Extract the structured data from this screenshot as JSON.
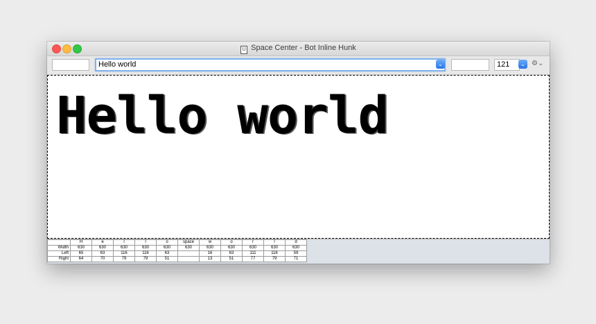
{
  "window": {
    "title": "Space Center - Bot Inline Hunk",
    "doc_icon": "U"
  },
  "toolbar": {
    "field1_value": "",
    "text_value": "Hello world",
    "field3_value": "",
    "size_value": "121"
  },
  "canvas": {
    "preview_text": "Hello world"
  },
  "metrics": {
    "row_labels": [
      "Width",
      "Left",
      "Right"
    ],
    "glyphs": [
      "H",
      "e",
      "l",
      "l",
      "o",
      "space",
      "w",
      "o",
      "r",
      "l",
      "d"
    ],
    "width": [
      "630",
      "630",
      "630",
      "630",
      "630",
      "630",
      "630",
      "630",
      "630",
      "630",
      "630"
    ],
    "left": [
      "65",
      "63",
      "116",
      "116",
      "63",
      "",
      "16",
      "63",
      "111",
      "116",
      "59"
    ],
    "right": [
      "64",
      "70",
      "79",
      "79",
      "51",
      "",
      "13",
      "51",
      "77",
      "79",
      "71"
    ]
  },
  "colors": {
    "accent": "#3b7de9",
    "close": "#fc5753",
    "minimize": "#fdbc40",
    "maximize": "#33c748"
  },
  "icons": [
    "close-icon",
    "minimize-icon",
    "maximize-icon",
    "document-icon",
    "chevron-down-icon",
    "gear-icon"
  ]
}
